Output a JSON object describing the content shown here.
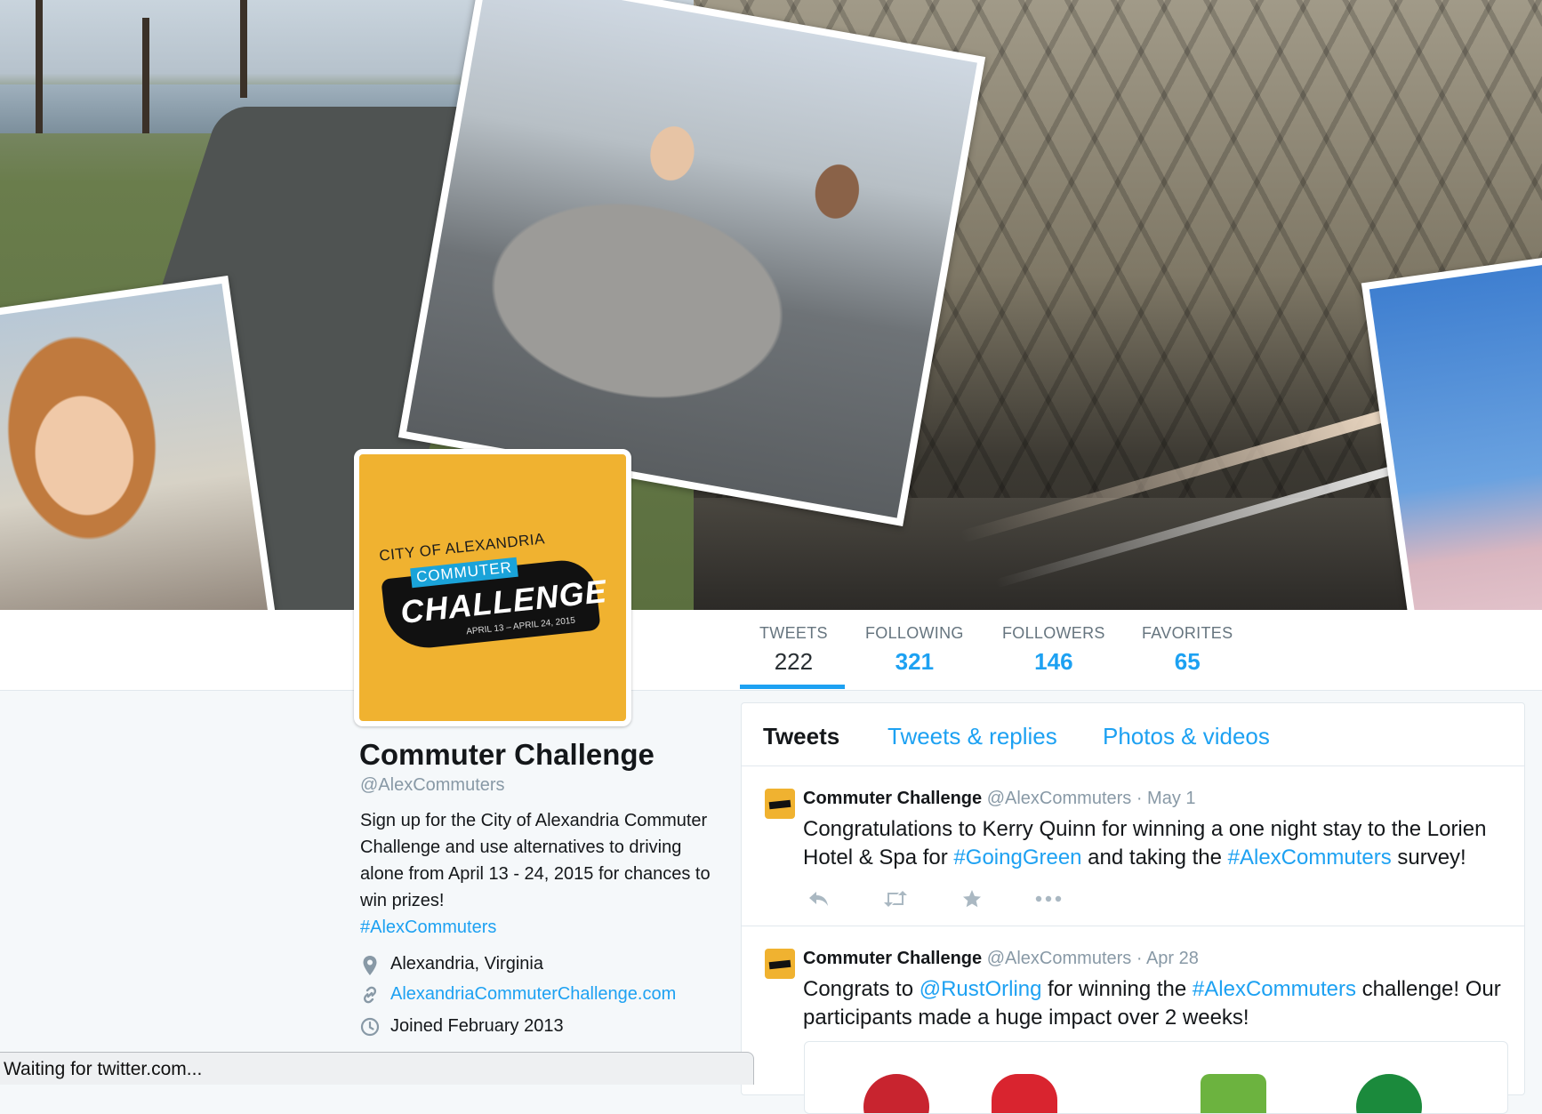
{
  "header": {
    "photos": [
      "bike-trail-photo",
      "woman-photo",
      "car-photo",
      "subway-photo",
      "blossom-photo"
    ]
  },
  "avatar": {
    "city": "CITY OF ALEXANDRIA",
    "commuter": "COMMUTER",
    "challenge": "CHALLENGE",
    "dates": "APRIL 13 – APRIL 24, 2015"
  },
  "stats": [
    {
      "label": "TWEETS",
      "value": "222"
    },
    {
      "label": "FOLLOWING",
      "value": "321"
    },
    {
      "label": "FOLLOWERS",
      "value": "146"
    },
    {
      "label": "FAVORITES",
      "value": "65"
    }
  ],
  "profile": {
    "name": "Commuter Challenge",
    "handle": "@AlexCommuters",
    "bio": "Sign up for the City of Alexandria Commuter Challenge and use alternatives to driving alone from April 13 - 24, 2015 for chances to win prizes!",
    "bio_hashtag": "#AlexCommuters",
    "location": "Alexandria, Virginia",
    "website": "AlexandriaCommuterChallenge.com",
    "joined": "Joined February 2013"
  },
  "timeline": {
    "tabs": [
      "Tweets",
      "Tweets & replies",
      "Photos & videos"
    ],
    "tweets": [
      {
        "name": "Commuter Challenge",
        "handle": "@AlexCommuters",
        "date": "· May 1",
        "text_1": "Congratulations to Kerry Quinn for winning a one night stay to the Lorien Hotel & Spa for ",
        "link_1": "#GoingGreen",
        "text_2": " and taking the ",
        "link_2": "#AlexCommuters",
        "text_3": " survey!"
      },
      {
        "name": "Commuter Challenge",
        "handle": "@AlexCommuters",
        "date": "· Apr 28",
        "text_1": "Congrats to ",
        "link_1": "@RustOrling",
        "text_2": " for winning the ",
        "link_2": "#AlexCommuters",
        "text_3": " challenge! Our participants made a huge impact over 2 weeks!"
      }
    ]
  },
  "status_bar": "Waiting for twitter.com...",
  "colors": {
    "accent": "#1da1f2",
    "avatar_bg": "#f0b230"
  }
}
